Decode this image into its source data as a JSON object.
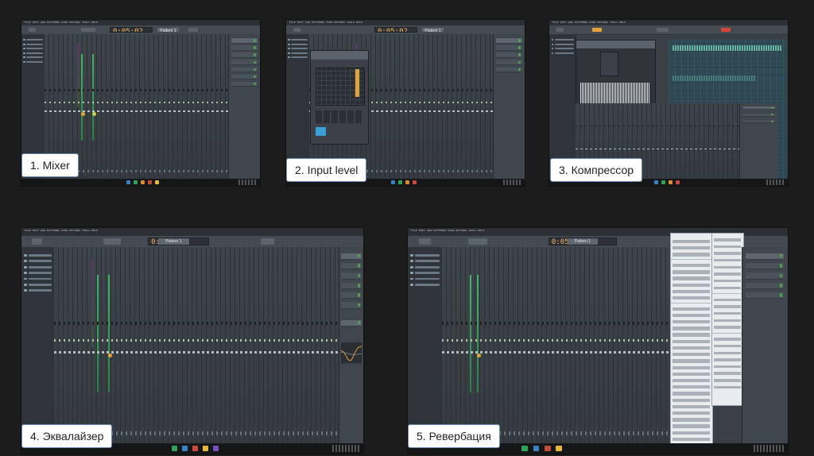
{
  "slides": [
    {
      "label": "1. Mixer"
    },
    {
      "label": "2. Input level"
    },
    {
      "label": "3. Компрессор"
    },
    {
      "label": "4. Эквалайзер"
    },
    {
      "label": "5. Ревербация"
    }
  ],
  "fl_studio": {
    "menu_bar": "FILE  EDIT  ADD  PATTERNS  VIEW  OPTIONS  TOOLS  HELP",
    "tempo": "0:05:02",
    "pattern_label": "Pattern 1"
  },
  "colors": {
    "background": "#1c1c1c",
    "label_bg": "#ffffff",
    "label_border": "#6a8bb1",
    "accent_orange": "#e6a33a",
    "meter_green": "#43b56a"
  }
}
